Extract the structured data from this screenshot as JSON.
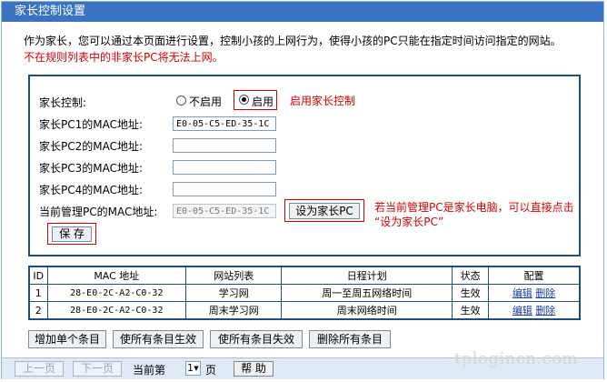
{
  "title": "家长控制设置",
  "intro": {
    "line1": "作为家长，您可以通过本页面进行设置，控制小孩的上网行为，使得小孩的PC只能在指定时间访问指定的网站。",
    "line2": "不在规则列表中的非家长PC将无法上网。"
  },
  "form": {
    "parental_control_label": "家长控制:",
    "radio_disable": "不启用",
    "radio_enable": "启用",
    "selected": "enable",
    "pc1_label": "家长PC1的MAC地址:",
    "pc1_value": "E0-05-C5-ED-35-1C",
    "pc2_label": "家长PC2的MAC地址:",
    "pc2_value": "",
    "pc3_label": "家长PC3的MAC地址:",
    "pc3_value": "",
    "pc4_label": "家长PC4的MAC地址:",
    "pc4_value": "",
    "current_pc_label": "当前管理PC的MAC地址:",
    "current_pc_value": "E0-05-C5-ED-35-1C",
    "set_parent_button": "设为家长PC",
    "save_button": "保 存"
  },
  "annotations": {
    "enable_note": "启用家长控制",
    "set_parent_note_line1": "若当前管理PC是家长电脑，可以直接点击",
    "set_parent_note_line2": "“设为家长PC”"
  },
  "table": {
    "headers": [
      "ID",
      "MAC 地址",
      "网站列表",
      "日程计划",
      "状态",
      "配置"
    ],
    "rows": [
      {
        "id": "1",
        "mac": "28-E0-2C-A2-C0-32",
        "sites": "学习网",
        "schedule": "周一至周五网络时间",
        "status": "生效",
        "edit": "编辑",
        "delete": "删除"
      },
      {
        "id": "2",
        "mac": "28-E0-2C-A2-C0-32",
        "sites": "周末学习网",
        "schedule": "周末网络时间",
        "status": "生效",
        "edit": "编辑",
        "delete": "删除"
      }
    ]
  },
  "actions": {
    "add": "增加单个条目",
    "enable_all": "使所有条目生效",
    "disable_all": "使所有条目失效",
    "delete_all": "删除所有条目"
  },
  "pager": {
    "prev": "上一页",
    "next": "下一页",
    "current_label": "当前第",
    "page_value": "1",
    "page_unit": "页",
    "help": "帮 助"
  },
  "watermark": "tplogincn.com",
  "colors": {
    "title_bar": "#3a73c4",
    "border": "#1e4a86",
    "warning": "#d40000",
    "pager_bg": "#dfeaf6"
  }
}
